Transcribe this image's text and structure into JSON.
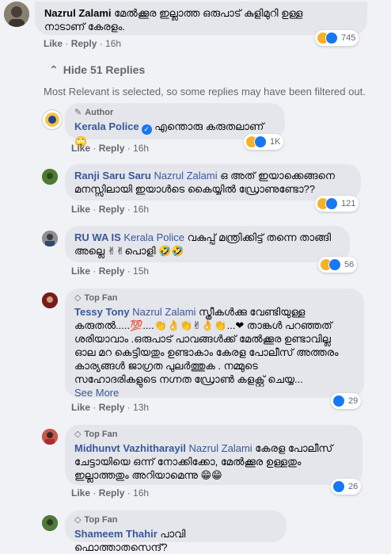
{
  "top_comment": {
    "name": "Nazrul Zalami",
    "text_line1": "മേൽക്കൂര ഇല്ലാത്ത ഒരുപാട് കുളിമുറി ഉള്ള",
    "text_line2": "നാടാണ് കേരളം.",
    "like": "Like",
    "reply": "Reply",
    "time": "16h",
    "reactions": "745"
  },
  "hide_replies": "Hide 51 Replies",
  "notice": "Most Relevant is selected, so some replies may have been filtered out.",
  "replies": [
    {
      "badge": "Author",
      "name": "Kerala Police",
      "text": "എന്തൊരു കരുതലാണ് 🙄",
      "like": "Like",
      "reply": "Reply",
      "time": "16h",
      "reactions": "1K"
    },
    {
      "name": "Ranji Saru Saru",
      "tag": "Nazrul Zalami",
      "text_line1": " ഒ അത് ഇയാക്കെങ്ങനെ",
      "text_line2": "മനസ്സിലായി ഇയാൾടെ കൈയ്യിൽ ഡ്രോണുണ്ടോ??",
      "like": "Like",
      "reply": "Reply",
      "time": "16h",
      "reactions": "121"
    },
    {
      "name": "RU WA IS",
      "tag": "Kerala Police",
      "text_line1": " വകുപ്പ് മന്ത്രിക്കിട്ട് തന്നെ താങ്ങി",
      "text_line2": "അല്ലെ ✌✌പൊളി 🤣🤣",
      "like": "Like",
      "reply": "Reply",
      "time": "15h",
      "reactions": "56"
    },
    {
      "badge": "Top Fan",
      "name": "Tessy Tony",
      "tag": "Nazrul Zalami",
      "text_line1": " സ്ത്രീകൾക്കു വേണ്ടിയുള്ള",
      "text_line2": "കരുതൽ.....💯....👏👌👏✌👌👏...❤ താങ്കൾ പറഞ്ഞത്",
      "text_line3": "ശരിയാവാം .ഒരുപാട് പാവങ്ങൾക്ക് മേൽക്കൂര ഉണ്ടാവില്ല",
      "text_line4": "ഓല മറ കെട്ടിയതും ഉണ്ടാകാം കേരള പോലീസ് അത്തരം",
      "text_line5": "കാര്യങ്ങൾ ജാഗ്രത പുലർത്തുക . നമ്മുടെ",
      "text_line6": "സഹോദരികളുടെ നഗ്നത ഡ്രോൺ കളക്റ്റ് ചെയ്യ...",
      "see_more": "See More",
      "like": "Like",
      "reply": "Reply",
      "time": "13h",
      "reactions": "29"
    },
    {
      "badge": "Top Fan",
      "name": "Midhunvt Vazhitharayil",
      "tag": "Nazrul Zalami",
      "text_line1": " കേരള പോലീസ്",
      "text_line2": "ചേട്ടായിയെ ഒന്ന് നോക്കിക്കോ, മേൽക്കൂര ഉള്ളതും",
      "text_line3": "ഇല്ലാത്തതും അറിയാമെന്നു 😁😁",
      "like": "Like",
      "reply": "Reply",
      "time": "16h",
      "reactions": "26"
    },
    {
      "badge": "Top Fan",
      "name": "Shameem Thahir",
      "text": " പാവി ഫൊത്താതസെന്ദ്?"
    }
  ],
  "colors": {
    "background": "#f0f2f5",
    "bubble": "#e4e6eb",
    "link": "#385898",
    "like_blue": "#1877f2",
    "haha_yellow": "#f7b125"
  }
}
